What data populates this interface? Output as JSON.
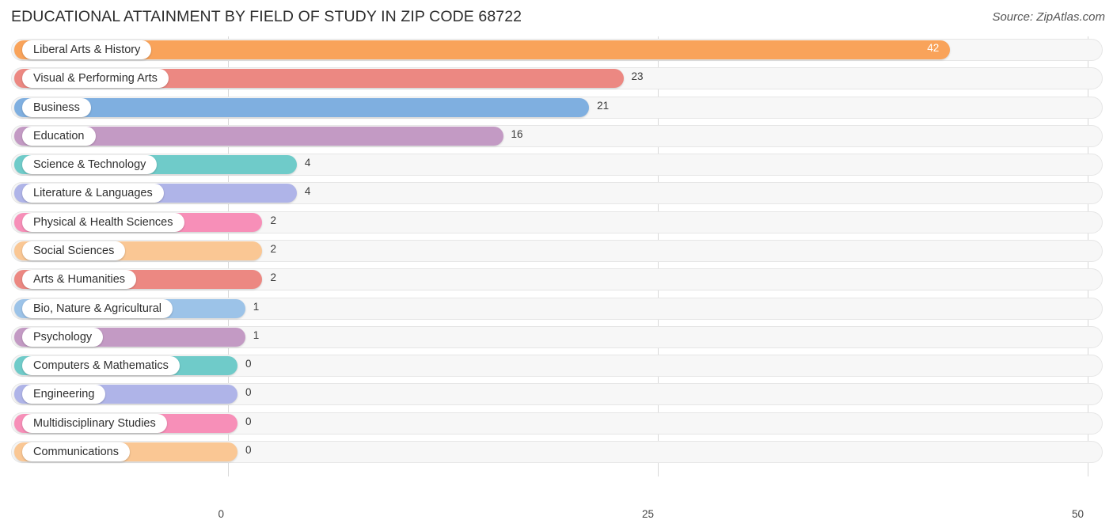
{
  "header": {
    "title": "EDUCATIONAL ATTAINMENT BY FIELD OF STUDY IN ZIP CODE 68722",
    "source": "Source: ZipAtlas.com"
  },
  "chart_data": {
    "type": "bar",
    "orientation": "horizontal",
    "title": "EDUCATIONAL ATTAINMENT BY FIELD OF STUDY IN ZIP CODE 68722",
    "xlabel": "",
    "ylabel": "",
    "xlim": [
      0,
      50
    ],
    "xticks": [
      0,
      25,
      50
    ],
    "xtick_labels": [
      "0",
      "25",
      "50"
    ],
    "grid": true,
    "legend": false,
    "categories": [
      "Liberal Arts & History",
      "Visual & Performing Arts",
      "Business",
      "Education",
      "Science & Technology",
      "Literature & Languages",
      "Physical & Health Sciences",
      "Social Sciences",
      "Arts & Humanities",
      "Bio, Nature & Agricultural",
      "Psychology",
      "Computers & Mathematics",
      "Engineering",
      "Multidisciplinary Studies",
      "Communications"
    ],
    "values": [
      42,
      23,
      21,
      16,
      4,
      4,
      2,
      2,
      2,
      1,
      1,
      0,
      0,
      0,
      0
    ],
    "value_labels": [
      "42",
      "23",
      "21",
      "16",
      "4",
      "4",
      "2",
      "2",
      "2",
      "1",
      "1",
      "0",
      "0",
      "0",
      "0"
    ],
    "colors": [
      "#f9a35a",
      "#ec8882",
      "#7fafe0",
      "#c39ac4",
      "#6fcbc9",
      "#afb4e8",
      "#f78fb8",
      "#fac794",
      "#ec8882",
      "#9cc3e8",
      "#c39ac4",
      "#6fcbc9",
      "#afb4e8",
      "#f78fb8",
      "#fac794"
    ]
  }
}
